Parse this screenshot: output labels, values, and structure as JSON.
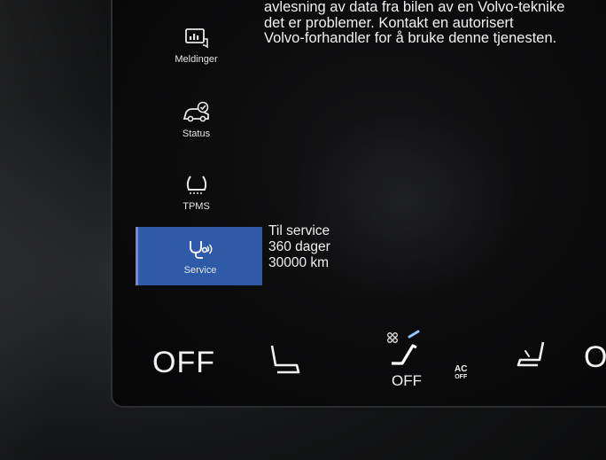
{
  "message": {
    "text": "avlesning av data fra bilen av en Volvo-teknike\ndet er problemer. Kontakt en autorisert\nVolvo-forhandler for å bruke denne tjenesten."
  },
  "sidebar": {
    "items": [
      {
        "label": "Meldinger",
        "icon": "messages-icon"
      },
      {
        "label": "Status",
        "icon": "car-status-icon"
      },
      {
        "label": "TPMS",
        "icon": "tire-pressure-icon"
      },
      {
        "label": "Service",
        "icon": "stethoscope-icon",
        "active": true
      }
    ]
  },
  "service": {
    "title": "Til service",
    "days": "360 dager",
    "distance": "30000 km"
  },
  "climate": {
    "left_temp": "OFF",
    "fan_label": "OFF",
    "ac_label": "AC",
    "ac_sub": "OFF",
    "right_temp_partial": "O"
  },
  "colors": {
    "active_tab": "#2f5aa8",
    "screen_bg": "#0b0b0c",
    "text": "#f0f0f0"
  }
}
